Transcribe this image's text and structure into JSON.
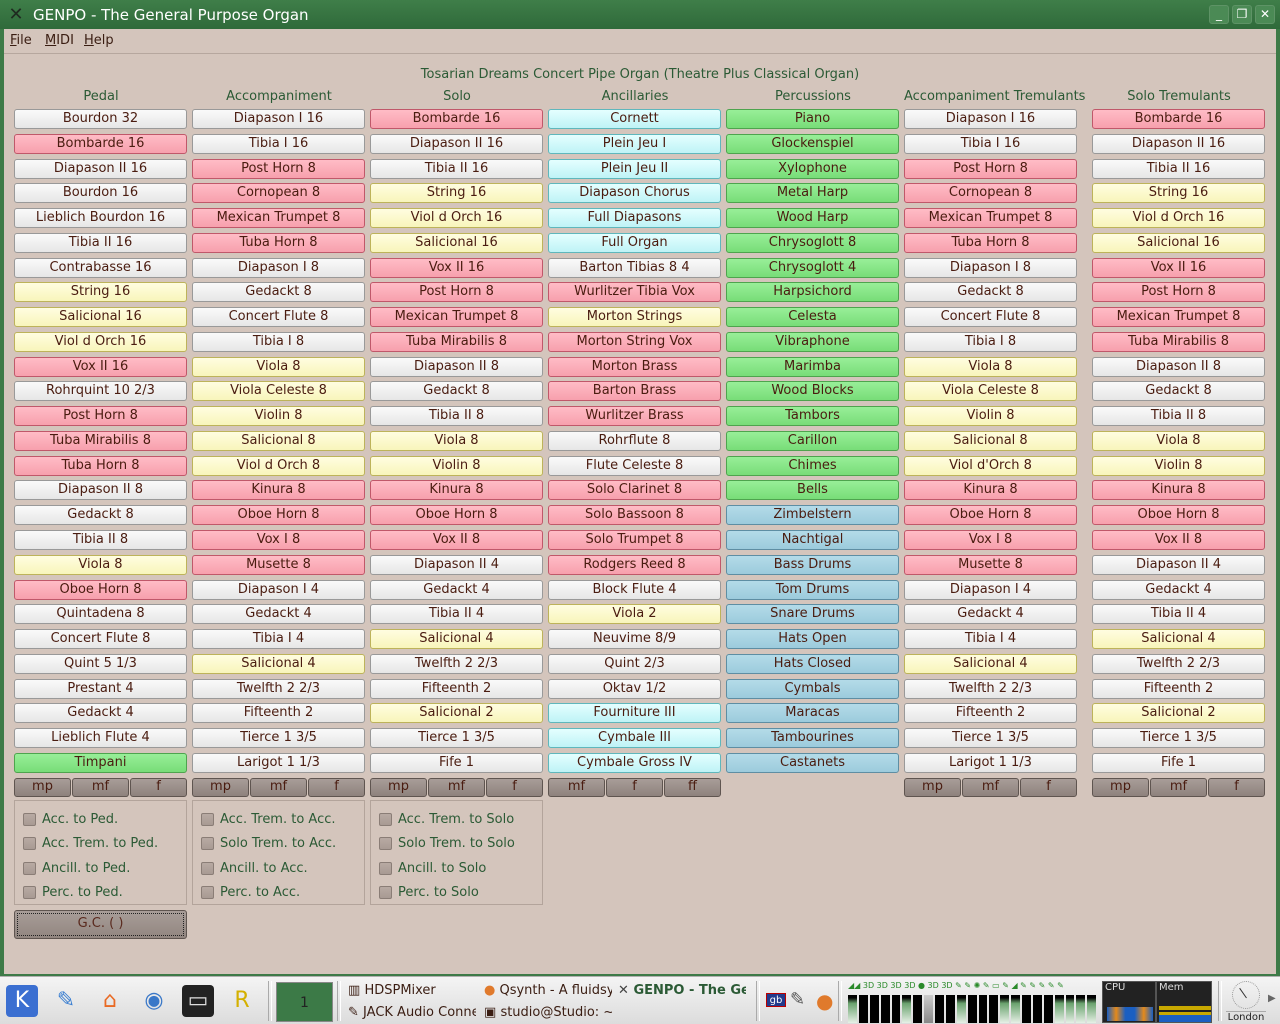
{
  "window": {
    "title": "GENPO - The General Purpose Organ",
    "controls": {
      "minimize": "_",
      "maximize": "❐",
      "close": "✕"
    }
  },
  "menu": [
    {
      "label": "File",
      "mnemonic": "F"
    },
    {
      "label": "MIDI",
      "mnemonic": "M"
    },
    {
      "label": "Help",
      "mnemonic": "H"
    }
  ],
  "organ_title": "Tosarian Dreams Concert Pipe Organ (Theatre Plus Classical Organ)",
  "colors": {
    "title_bar": "#3d7a47",
    "background": "#d4c5bc",
    "label_green": "#2b5a35",
    "stop_text": "#4a1c10",
    "pink": "#f7a0ad",
    "yellow": "#f8f5bb",
    "cyan": "#bff3f6",
    "green": "#78dd78",
    "blue": "#9ccbdc",
    "white": "#eeeeee"
  },
  "divisions": [
    {
      "name": "Pedal",
      "stops": [
        {
          "label": "Bourdon 32",
          "color": "white"
        },
        {
          "label": "Bombarde 16",
          "color": "pink"
        },
        {
          "label": "Diapason II 16",
          "color": "white"
        },
        {
          "label": "Bourdon 16",
          "color": "white"
        },
        {
          "label": "Lieblich Bourdon 16",
          "color": "white"
        },
        {
          "label": "Tibia II 16",
          "color": "white"
        },
        {
          "label": "Contrabasse 16",
          "color": "white"
        },
        {
          "label": "String 16",
          "color": "yellow"
        },
        {
          "label": "Salicional 16",
          "color": "yellow"
        },
        {
          "label": "Viol d Orch 16",
          "color": "yellow"
        },
        {
          "label": "Vox II 16",
          "color": "pink"
        },
        {
          "label": "Rohrquint 10 2/3",
          "color": "white"
        },
        {
          "label": "Post Horn 8",
          "color": "pink"
        },
        {
          "label": "Tuba Mirabilis 8",
          "color": "pink"
        },
        {
          "label": "Tuba Horn 8",
          "color": "pink"
        },
        {
          "label": "Diapason II 8",
          "color": "white"
        },
        {
          "label": "Gedackt 8",
          "color": "white"
        },
        {
          "label": "Tibia II 8",
          "color": "white"
        },
        {
          "label": "Viola 8",
          "color": "yellow"
        },
        {
          "label": "Oboe Horn 8",
          "color": "pink"
        },
        {
          "label": "Quintadena 8",
          "color": "white"
        },
        {
          "label": "Concert Flute 8",
          "color": "white"
        },
        {
          "label": "Quint 5 1/3",
          "color": "white"
        },
        {
          "label": "Prestant 4",
          "color": "white"
        },
        {
          "label": "Gedackt 4",
          "color": "white"
        },
        {
          "label": "Lieblich Flute 4",
          "color": "white"
        },
        {
          "label": "Timpani",
          "color": "green"
        }
      ],
      "dynamics": [
        "mp",
        "mf",
        "f"
      ],
      "couplers": [
        "Acc. to Ped.",
        "Acc. Trem. to Ped.",
        "Ancill. to Ped.",
        "Perc. to Ped."
      ]
    },
    {
      "name": "Accompaniment",
      "stops": [
        {
          "label": "Diapason I 16",
          "color": "white"
        },
        {
          "label": "Tibia I 16",
          "color": "white"
        },
        {
          "label": "Post Horn 8",
          "color": "pink"
        },
        {
          "label": "Cornopean 8",
          "color": "pink"
        },
        {
          "label": "Mexican Trumpet 8",
          "color": "pink"
        },
        {
          "label": "Tuba Horn 8",
          "color": "pink"
        },
        {
          "label": "Diapason I 8",
          "color": "white"
        },
        {
          "label": "Gedackt 8",
          "color": "white"
        },
        {
          "label": "Concert Flute 8",
          "color": "white"
        },
        {
          "label": "Tibia I 8",
          "color": "white"
        },
        {
          "label": "Viola 8",
          "color": "yellow"
        },
        {
          "label": "Viola Celeste 8",
          "color": "yellow"
        },
        {
          "label": "Violin 8",
          "color": "yellow"
        },
        {
          "label": "Salicional 8",
          "color": "yellow"
        },
        {
          "label": "Viol d Orch 8",
          "color": "yellow"
        },
        {
          "label": "Kinura 8",
          "color": "pink"
        },
        {
          "label": "Oboe Horn 8",
          "color": "pink"
        },
        {
          "label": "Vox I 8",
          "color": "pink"
        },
        {
          "label": "Musette 8",
          "color": "pink"
        },
        {
          "label": "Diapason I 4",
          "color": "white"
        },
        {
          "label": "Gedackt 4",
          "color": "white"
        },
        {
          "label": "Tibia I 4",
          "color": "white"
        },
        {
          "label": "Salicional 4",
          "color": "yellow"
        },
        {
          "label": "Twelfth 2 2/3",
          "color": "white"
        },
        {
          "label": "Fifteenth 2",
          "color": "white"
        },
        {
          "label": "Tierce 1 3/5",
          "color": "white"
        },
        {
          "label": "Larigot 1 1/3",
          "color": "white"
        }
      ],
      "dynamics": [
        "mp",
        "mf",
        "f"
      ],
      "couplers": [
        "Acc. Trem. to Acc.",
        "Solo Trem. to Acc.",
        "Ancill. to Acc.",
        "Perc. to Acc."
      ]
    },
    {
      "name": "Solo",
      "stops": [
        {
          "label": "Bombarde 16",
          "color": "pink"
        },
        {
          "label": "Diapason II 16",
          "color": "white"
        },
        {
          "label": "Tibia II 16",
          "color": "white"
        },
        {
          "label": "String 16",
          "color": "yellow"
        },
        {
          "label": "Viol d Orch 16",
          "color": "yellow"
        },
        {
          "label": "Salicional 16",
          "color": "yellow"
        },
        {
          "label": "Vox II 16",
          "color": "pink"
        },
        {
          "label": "Post Horn 8",
          "color": "pink"
        },
        {
          "label": "Mexican Trumpet 8",
          "color": "pink"
        },
        {
          "label": "Tuba Mirabilis 8",
          "color": "pink"
        },
        {
          "label": "Diapason II 8",
          "color": "white"
        },
        {
          "label": "Gedackt 8",
          "color": "white"
        },
        {
          "label": "Tibia II 8",
          "color": "white"
        },
        {
          "label": "Viola 8",
          "color": "yellow"
        },
        {
          "label": "Violin 8",
          "color": "yellow"
        },
        {
          "label": "Kinura 8",
          "color": "pink"
        },
        {
          "label": "Oboe Horn 8",
          "color": "pink"
        },
        {
          "label": "Vox II 8",
          "color": "pink"
        },
        {
          "label": "Diapason II 4",
          "color": "white"
        },
        {
          "label": "Gedackt 4",
          "color": "white"
        },
        {
          "label": "Tibia II 4",
          "color": "white"
        },
        {
          "label": "Salicional 4",
          "color": "yellow"
        },
        {
          "label": "Twelfth 2 2/3",
          "color": "white"
        },
        {
          "label": "Fifteenth 2",
          "color": "white"
        },
        {
          "label": "Salicional 2",
          "color": "yellow"
        },
        {
          "label": "Tierce 1 3/5",
          "color": "white"
        },
        {
          "label": "Fife 1",
          "color": "white"
        }
      ],
      "dynamics": [
        "mp",
        "mf",
        "f"
      ],
      "couplers": [
        "Acc. Trem. to Solo",
        "Solo Trem. to Solo",
        "Ancill. to Solo",
        "Perc. to Solo"
      ]
    },
    {
      "name": "Ancillaries",
      "stops": [
        {
          "label": "Cornett",
          "color": "cyan"
        },
        {
          "label": "Plein Jeu I",
          "color": "cyan"
        },
        {
          "label": "Plein Jeu II",
          "color": "cyan"
        },
        {
          "label": "Diapason Chorus",
          "color": "cyan"
        },
        {
          "label": "Full Diapasons",
          "color": "cyan"
        },
        {
          "label": "Full Organ",
          "color": "cyan"
        },
        {
          "label": "Barton Tibias 8 4",
          "color": "white"
        },
        {
          "label": "Wurlitzer Tibia Vox",
          "color": "pink"
        },
        {
          "label": "Morton Strings",
          "color": "yellow"
        },
        {
          "label": "Morton String Vox",
          "color": "pink"
        },
        {
          "label": "Morton Brass",
          "color": "pink"
        },
        {
          "label": "Barton Brass",
          "color": "pink"
        },
        {
          "label": "Wurlitzer Brass",
          "color": "pink"
        },
        {
          "label": "Rohrflute 8",
          "color": "white"
        },
        {
          "label": "Flute Celeste 8",
          "color": "white"
        },
        {
          "label": "Solo Clarinet 8",
          "color": "pink"
        },
        {
          "label": "Solo Bassoon 8",
          "color": "pink"
        },
        {
          "label": "Solo Trumpet 8",
          "color": "pink"
        },
        {
          "label": "Rodgers Reed 8",
          "color": "pink"
        },
        {
          "label": "Block Flute 4",
          "color": "white"
        },
        {
          "label": "Viola 2",
          "color": "yellow"
        },
        {
          "label": "Neuvime 8/9",
          "color": "white"
        },
        {
          "label": "Quint 2/3",
          "color": "white"
        },
        {
          "label": "Oktav 1/2",
          "color": "white"
        },
        {
          "label": "Fourniture III",
          "color": "cyan"
        },
        {
          "label": "Cymbale III",
          "color": "cyan"
        },
        {
          "label": "Cymbale Gross IV",
          "color": "cyan"
        }
      ],
      "dynamics": [
        "mf",
        "f",
        "ff"
      ]
    },
    {
      "name": "Percussions",
      "stops": [
        {
          "label": "Piano",
          "color": "green"
        },
        {
          "label": "Glockenspiel",
          "color": "green"
        },
        {
          "label": "Xylophone",
          "color": "green"
        },
        {
          "label": "Metal Harp",
          "color": "green"
        },
        {
          "label": "Wood Harp",
          "color": "green"
        },
        {
          "label": "Chrysoglott 8",
          "color": "green"
        },
        {
          "label": "Chrysoglott 4",
          "color": "green"
        },
        {
          "label": "Harpsichord",
          "color": "green"
        },
        {
          "label": "Celesta",
          "color": "green"
        },
        {
          "label": "Vibraphone",
          "color": "green"
        },
        {
          "label": "Marimba",
          "color": "green"
        },
        {
          "label": "Wood Blocks",
          "color": "green"
        },
        {
          "label": "Tambors",
          "color": "green"
        },
        {
          "label": "Carillon",
          "color": "green"
        },
        {
          "label": "Chimes",
          "color": "green"
        },
        {
          "label": "Bells",
          "color": "green"
        },
        {
          "label": "Zimbelstern",
          "color": "blue"
        },
        {
          "label": "Nachtigal",
          "color": "blue"
        },
        {
          "label": "Bass Drums",
          "color": "blue"
        },
        {
          "label": "Tom Drums",
          "color": "blue"
        },
        {
          "label": "Snare Drums",
          "color": "blue"
        },
        {
          "label": "Hats Open",
          "color": "blue"
        },
        {
          "label": "Hats Closed",
          "color": "blue"
        },
        {
          "label": "Cymbals",
          "color": "blue"
        },
        {
          "label": "Maracas",
          "color": "blue"
        },
        {
          "label": "Tambourines",
          "color": "blue"
        },
        {
          "label": "Castanets",
          "color": "blue"
        }
      ],
      "dynamics": []
    },
    {
      "name": "Accompaniment Tremulants",
      "stops": [
        {
          "label": "Diapason I 16",
          "color": "white"
        },
        {
          "label": "Tibia I 16",
          "color": "white"
        },
        {
          "label": "Post Horn 8",
          "color": "pink"
        },
        {
          "label": "Cornopean 8",
          "color": "pink"
        },
        {
          "label": "Mexican Trumpet 8",
          "color": "pink"
        },
        {
          "label": "Tuba Horn 8",
          "color": "pink"
        },
        {
          "label": "Diapason I 8",
          "color": "white"
        },
        {
          "label": "Gedackt 8",
          "color": "white"
        },
        {
          "label": "Concert Flute 8",
          "color": "white"
        },
        {
          "label": "Tibia I 8",
          "color": "white"
        },
        {
          "label": "Viola 8",
          "color": "yellow"
        },
        {
          "label": "Viola Celeste 8",
          "color": "yellow"
        },
        {
          "label": "Violin 8",
          "color": "yellow"
        },
        {
          "label": "Salicional 8",
          "color": "yellow"
        },
        {
          "label": "Viol d'Orch 8",
          "color": "yellow"
        },
        {
          "label": "Kinura 8",
          "color": "pink"
        },
        {
          "label": "Oboe Horn 8",
          "color": "pink"
        },
        {
          "label": "Vox I 8",
          "color": "pink"
        },
        {
          "label": "Musette 8",
          "color": "pink"
        },
        {
          "label": "Diapason I 4",
          "color": "white"
        },
        {
          "label": "Gedackt 4",
          "color": "white"
        },
        {
          "label": "Tibia I 4",
          "color": "white"
        },
        {
          "label": "Salicional 4",
          "color": "yellow"
        },
        {
          "label": "Twelfth 2 2/3",
          "color": "white"
        },
        {
          "label": "Fifteenth 2",
          "color": "white"
        },
        {
          "label": "Tierce 1 3/5",
          "color": "white"
        },
        {
          "label": "Larigot 1 1/3",
          "color": "white"
        }
      ],
      "dynamics": [
        "mp",
        "mf",
        "f"
      ]
    },
    {
      "name": "Solo Tremulants",
      "stops": [
        {
          "label": "Bombarde 16",
          "color": "pink"
        },
        {
          "label": "Diapason II 16",
          "color": "white"
        },
        {
          "label": "Tibia II 16",
          "color": "white"
        },
        {
          "label": "String 16",
          "color": "yellow"
        },
        {
          "label": "Viol d Orch 16",
          "color": "yellow"
        },
        {
          "label": "Salicional 16",
          "color": "yellow"
        },
        {
          "label": "Vox II 16",
          "color": "pink"
        },
        {
          "label": "Post Horn 8",
          "color": "pink"
        },
        {
          "label": "Mexican Trumpet 8",
          "color": "pink"
        },
        {
          "label": "Tuba Mirabilis 8",
          "color": "pink"
        },
        {
          "label": "Diapason II 8",
          "color": "white"
        },
        {
          "label": "Gedackt 8",
          "color": "white"
        },
        {
          "label": "Tibia II 8",
          "color": "white"
        },
        {
          "label": "Viola 8",
          "color": "yellow"
        },
        {
          "label": "Violin 8",
          "color": "yellow"
        },
        {
          "label": "Kinura 8",
          "color": "pink"
        },
        {
          "label": "Oboe Horn 8",
          "color": "pink"
        },
        {
          "label": "Vox II 8",
          "color": "pink"
        },
        {
          "label": "Diapason II 4",
          "color": "white"
        },
        {
          "label": "Gedackt 4",
          "color": "white"
        },
        {
          "label": "Tibia II 4",
          "color": "white"
        },
        {
          "label": "Salicional 4",
          "color": "yellow"
        },
        {
          "label": "Twelfth 2 2/3",
          "color": "white"
        },
        {
          "label": "Fifteenth 2",
          "color": "white"
        },
        {
          "label": "Salicional 2",
          "color": "yellow"
        },
        {
          "label": "Tierce 1 3/5",
          "color": "white"
        },
        {
          "label": "Fife 1",
          "color": "white"
        }
      ],
      "dynamics": [
        "mp",
        "mf",
        "f"
      ]
    }
  ],
  "general_cancel": "G.C. ( )",
  "taskbar": {
    "launchers": [
      {
        "name": "kde-menu-icon",
        "glyph": "K"
      },
      {
        "name": "text-editor-icon",
        "glyph": "✎"
      },
      {
        "name": "home-folder-icon",
        "glyph": "⌂"
      },
      {
        "name": "web-browser-icon",
        "glyph": "◉"
      },
      {
        "name": "terminal-icon",
        "glyph": "▭"
      },
      {
        "name": "rosegarden-icon",
        "glyph": "R"
      }
    ],
    "pager_desktop": "1",
    "tasks": [
      {
        "label": "HDSPMixer",
        "icon": "▥"
      },
      {
        "label": "JACK Audio Conne",
        "icon": "✎"
      },
      {
        "label": "Qsynth - A fluidsy",
        "icon": "●"
      },
      {
        "label": "studio@Studio: ~",
        "icon": "▣"
      },
      {
        "label": "GENPO - The Ge",
        "icon": "✕",
        "active": true
      }
    ],
    "tray": {
      "keyboard_layout": "gb"
    },
    "sysmon": {
      "cpu_label": "CPU",
      "mem_label": "Mem"
    },
    "clock": {
      "city": "London"
    }
  }
}
